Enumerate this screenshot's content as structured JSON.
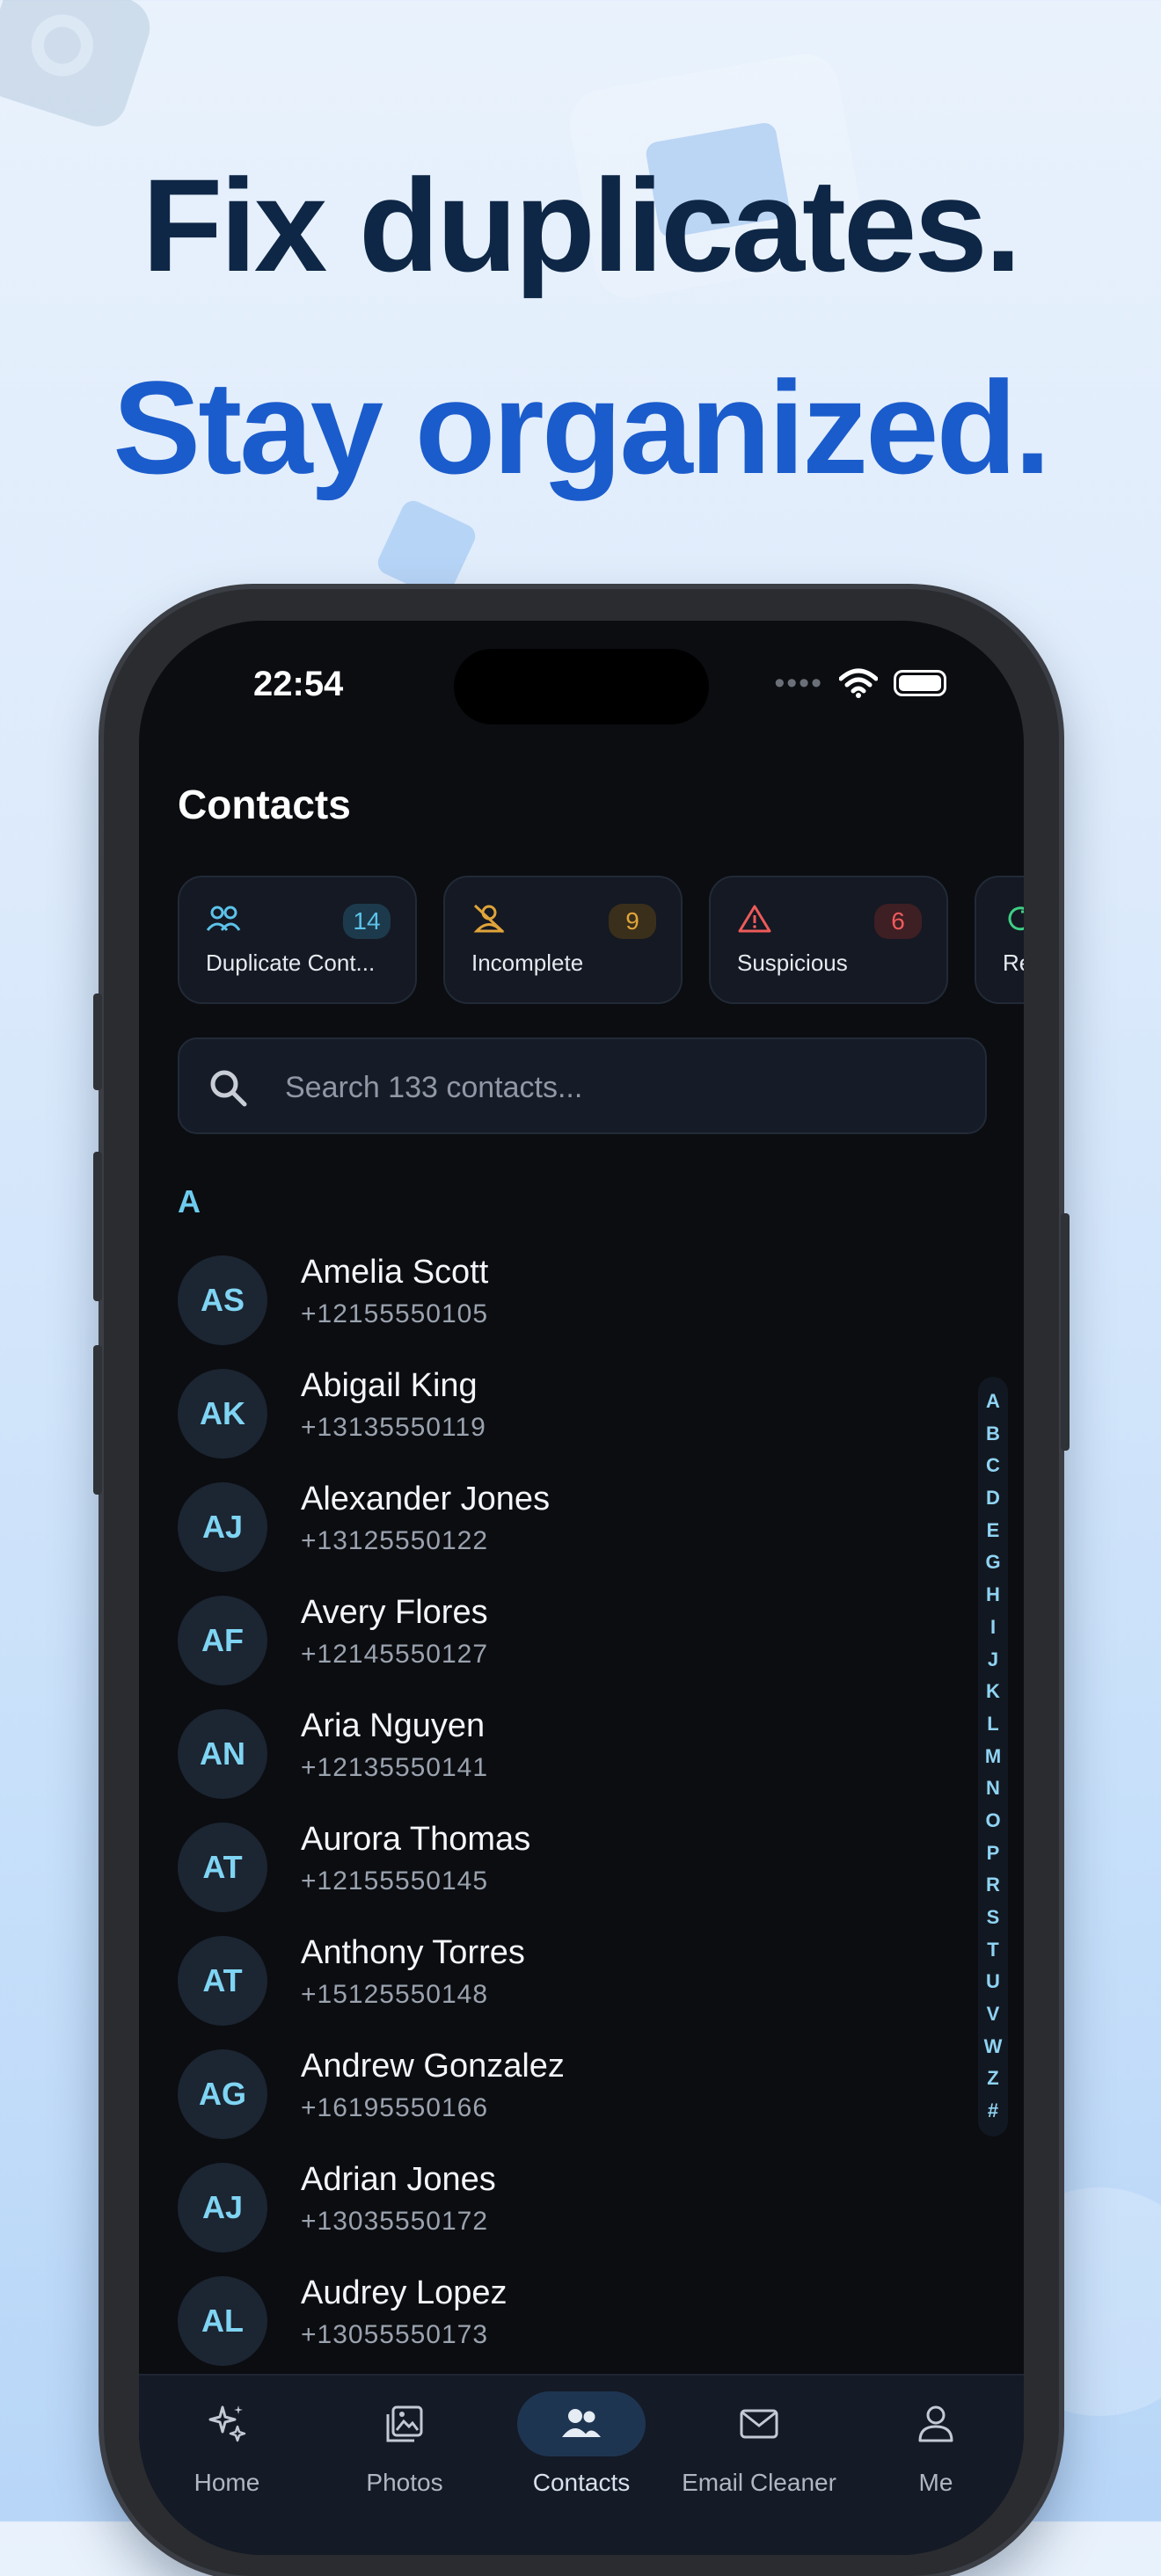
{
  "headline": {
    "line1": "Fix duplicates.",
    "line2": "Stay organized."
  },
  "status_bar": {
    "time": "22:54"
  },
  "screen": {
    "title": "Contacts"
  },
  "cards": [
    {
      "label": "Duplicate Cont...",
      "count": "14",
      "icon": "users-icon",
      "color": "#5cc3ea",
      "badge_bg": "#1d3a4c"
    },
    {
      "label": "Incomplete",
      "count": "9",
      "icon": "user-off-icon",
      "color": "#e0a43a",
      "badge_bg": "#3a2f1a"
    },
    {
      "label": "Suspicious",
      "count": "6",
      "icon": "warning-icon",
      "color": "#ef5a5a",
      "badge_bg": "#3e1f24"
    },
    {
      "label": "Re",
      "count": "",
      "icon": "refresh-icon",
      "color": "#3fcf84",
      "badge_bg": "#1b3a2b"
    }
  ],
  "search": {
    "placeholder": "Search 133 contacts..."
  },
  "section": {
    "letter": "A"
  },
  "contacts": [
    {
      "initials": "AS",
      "name": "Amelia Scott",
      "phone": "+12155550105"
    },
    {
      "initials": "AK",
      "name": "Abigail King",
      "phone": "+13135550119"
    },
    {
      "initials": "AJ",
      "name": "Alexander Jones",
      "phone": "+13125550122"
    },
    {
      "initials": "AF",
      "name": "Avery Flores",
      "phone": "+12145550127"
    },
    {
      "initials": "AN",
      "name": "Aria Nguyen",
      "phone": "+12135550141"
    },
    {
      "initials": "AT",
      "name": "Aurora Thomas",
      "phone": "+12155550145"
    },
    {
      "initials": "AT",
      "name": "Anthony Torres",
      "phone": "+15125550148"
    },
    {
      "initials": "AG",
      "name": "Andrew Gonzalez",
      "phone": "+16195550166"
    },
    {
      "initials": "AJ",
      "name": "Adrian Jones",
      "phone": "+13035550172"
    },
    {
      "initials": "AL",
      "name": "Audrey Lopez",
      "phone": "+13055550173"
    }
  ],
  "alpha_index": [
    "A",
    "B",
    "C",
    "D",
    "E",
    "G",
    "H",
    "I",
    "J",
    "K",
    "L",
    "M",
    "N",
    "O",
    "P",
    "R",
    "S",
    "T",
    "U",
    "V",
    "W",
    "Z",
    "#"
  ],
  "tabs": [
    {
      "label": "Home",
      "icon": "sparkles-icon",
      "active": false
    },
    {
      "label": "Photos",
      "icon": "photos-icon",
      "active": false
    },
    {
      "label": "Contacts",
      "icon": "contacts-icon",
      "active": true
    },
    {
      "label": "Email Cleaner",
      "icon": "mail-icon",
      "active": false
    },
    {
      "label": "Me",
      "icon": "person-icon",
      "active": false
    }
  ],
  "colors": {
    "headline_dark": "#0f2746",
    "headline_blue": "#1b5ccc",
    "screen_bg": "#0b0d11",
    "accent_cyan": "#7fd4f3"
  }
}
